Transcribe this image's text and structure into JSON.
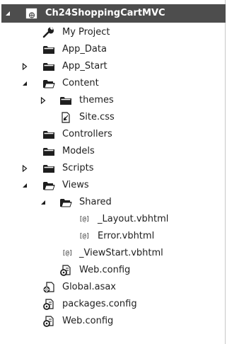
{
  "tree": {
    "items": [
      {
        "label": "Ch24ShoppingCartMVC",
        "level": 0,
        "expander": "expanded",
        "icon": "vb-web-project-icon",
        "selected": true
      },
      {
        "label": "My Project",
        "level": 1,
        "expander": "none",
        "icon": "wrench-icon"
      },
      {
        "label": "App_Data",
        "level": 1,
        "expander": "none",
        "icon": "folder-icon"
      },
      {
        "label": "App_Start",
        "level": 1,
        "expander": "collapsed",
        "icon": "folder-icon"
      },
      {
        "label": "Content",
        "level": 1,
        "expander": "expanded",
        "icon": "folder-open-icon"
      },
      {
        "label": "themes",
        "level": 2,
        "expander": "collapsed",
        "icon": "folder-icon"
      },
      {
        "label": "Site.css",
        "level": 2,
        "expander": "none",
        "icon": "css-file-icon"
      },
      {
        "label": "Controllers",
        "level": 1,
        "expander": "none",
        "icon": "folder-icon"
      },
      {
        "label": "Models",
        "level": 1,
        "expander": "none",
        "icon": "folder-icon"
      },
      {
        "label": "Scripts",
        "level": 1,
        "expander": "collapsed",
        "icon": "folder-icon"
      },
      {
        "label": "Views",
        "level": 1,
        "expander": "expanded",
        "icon": "folder-open-icon"
      },
      {
        "label": "Shared",
        "level": 2,
        "expander": "expanded",
        "icon": "folder-open-icon"
      },
      {
        "label": "_Layout.vbhtml",
        "level": 3,
        "expander": "none",
        "icon": "razor-file-icon"
      },
      {
        "label": "Error.vbhtml",
        "level": 3,
        "expander": "none",
        "icon": "razor-file-icon"
      },
      {
        "label": "_ViewStart.vbhtml",
        "level": 2,
        "expander": "none",
        "icon": "razor-file-icon"
      },
      {
        "label": "Web.config",
        "level": 2,
        "expander": "none",
        "icon": "config-file-icon"
      },
      {
        "label": "Global.asax",
        "level": 1,
        "expander": "none",
        "icon": "global-asax-icon"
      },
      {
        "label": "packages.config",
        "level": 1,
        "expander": "none",
        "icon": "config-file-icon"
      },
      {
        "label": "Web.config",
        "level": 1,
        "expander": "none",
        "icon": "config-file-icon"
      }
    ],
    "razor_glyph": "[@]"
  }
}
